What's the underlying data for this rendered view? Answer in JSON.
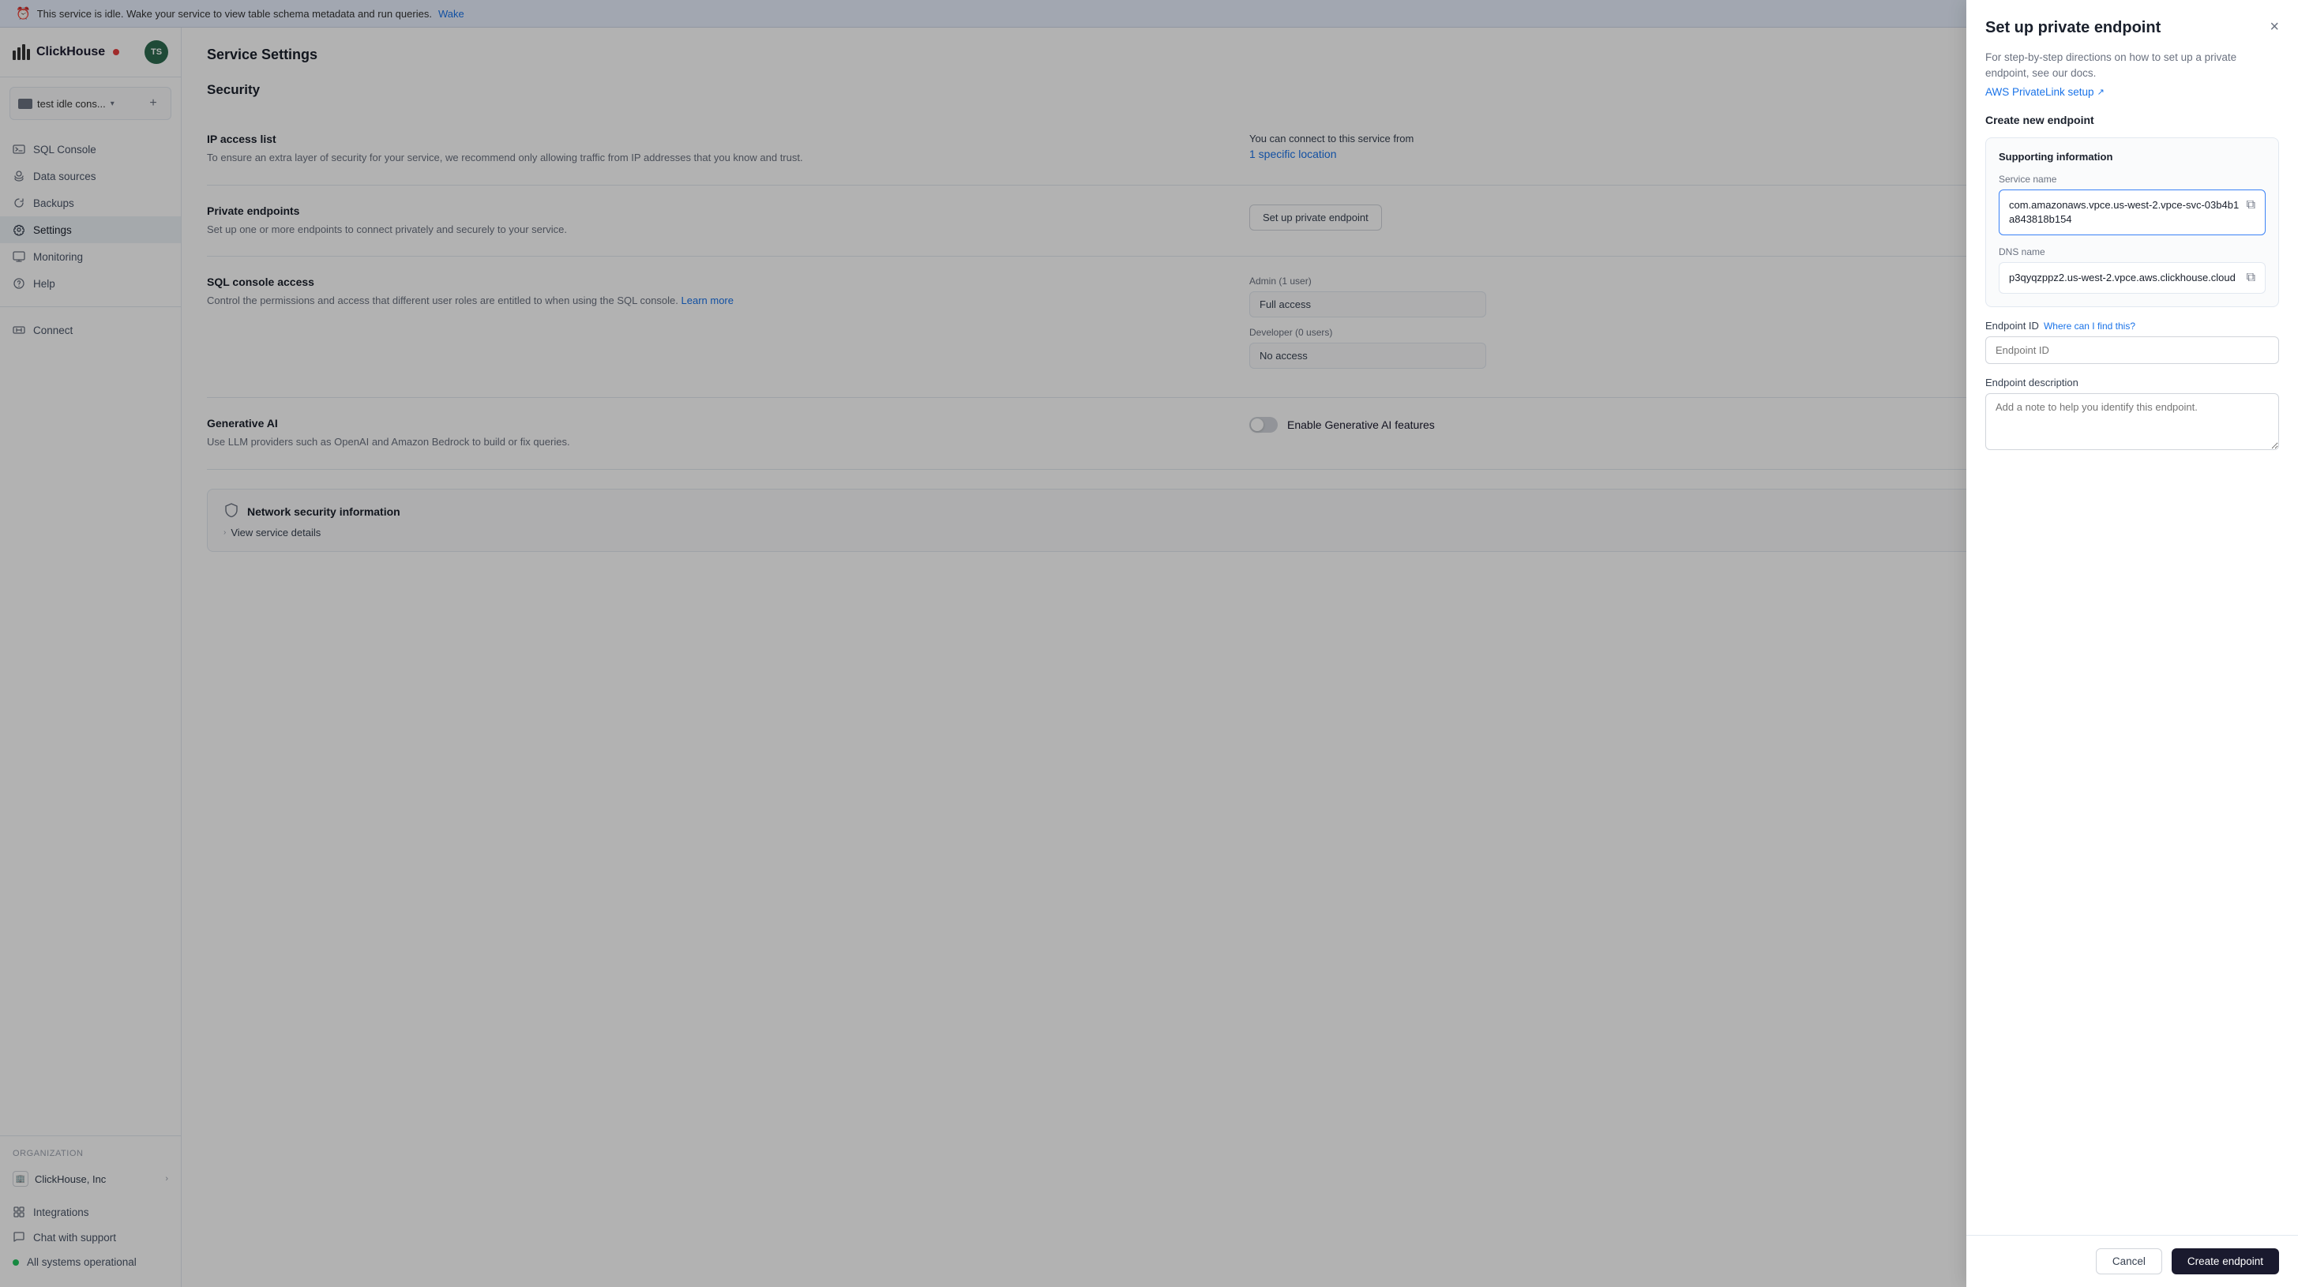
{
  "banner": {
    "text": "This service is idle. Wake your service to view table schema metadata and run queries.",
    "link_text": "Wake",
    "icon": "⏰"
  },
  "sidebar": {
    "logo": "ClickHouse",
    "avatar": "TS",
    "service_name": "test idle cons...",
    "nav_items": [
      {
        "id": "sql-console",
        "label": "SQL Console",
        "icon": "sql"
      },
      {
        "id": "data-sources",
        "label": "Data sources",
        "icon": "data"
      },
      {
        "id": "backups",
        "label": "Backups",
        "icon": "backup"
      },
      {
        "id": "settings",
        "label": "Settings",
        "icon": "settings",
        "active": true
      },
      {
        "id": "monitoring",
        "label": "Monitoring",
        "icon": "monitor"
      },
      {
        "id": "help",
        "label": "Help",
        "icon": "help"
      }
    ],
    "connect": "Connect",
    "org_label": "Organization",
    "org_name": "ClickHouse, Inc",
    "bottom_nav": [
      {
        "id": "integrations",
        "label": "Integrations",
        "icon": "integrations"
      },
      {
        "id": "chat-support",
        "label": "Chat with support",
        "icon": "chat"
      },
      {
        "id": "all-systems",
        "label": "All systems operational",
        "icon": "status"
      }
    ]
  },
  "main": {
    "page_title": "Service Settings",
    "section_title": "Security",
    "ip_access": {
      "label": "IP access list",
      "desc": "To ensure an extra layer of security for your service, we recommend only allowing traffic from IP addresses that you know and trust.",
      "connection_label": "You can connect to this service from",
      "location_text": "1 specific location"
    },
    "private_endpoints": {
      "label": "Private endpoints",
      "desc": "Set up one or more endpoints to connect privately and securely to your service.",
      "button": "Set up private endpoint"
    },
    "sql_console": {
      "label": "SQL console access",
      "desc": "Control the permissions and access that different user roles are entitled to when using the SQL console.",
      "learn_more": "Learn more",
      "admin_label": "Admin (1 user)",
      "admin_value": "Full access",
      "dev_label": "Developer (0 users)",
      "dev_value": "No access"
    },
    "generative_ai": {
      "label": "Generative AI",
      "desc": "Use LLM providers such as OpenAI and Amazon Bedrock to build or fix queries.",
      "toggle_label": "Enable Generative AI features"
    },
    "network_security": {
      "label": "Network security information",
      "view_details": "View service details"
    }
  },
  "panel": {
    "title": "Set up private endpoint",
    "desc": "For step-by-step directions on how to set up a private endpoint, see our docs.",
    "aws_link": "AWS PrivateLink setup",
    "close_icon": "×",
    "create_title": "Create new endpoint",
    "supporting_info_title": "Supporting information",
    "service_name_label": "Service name",
    "service_name_value": "com.amazonaws.vpce.us-west-2.vpce-svc-03b4b1a843818b154",
    "dns_name_label": "DNS name",
    "dns_name_value": "p3qyqzppz2.us-west-2.vpce.aws.clickhouse.cloud",
    "endpoint_id_label": "Endpoint ID",
    "endpoint_id_where": "Where can I find this?",
    "endpoint_id_placeholder": "Endpoint ID",
    "endpoint_desc_label": "Endpoint description",
    "endpoint_desc_placeholder": "Add a note to help you identify this endpoint.",
    "cancel_btn": "Cancel",
    "create_btn": "Create endpoint"
  }
}
